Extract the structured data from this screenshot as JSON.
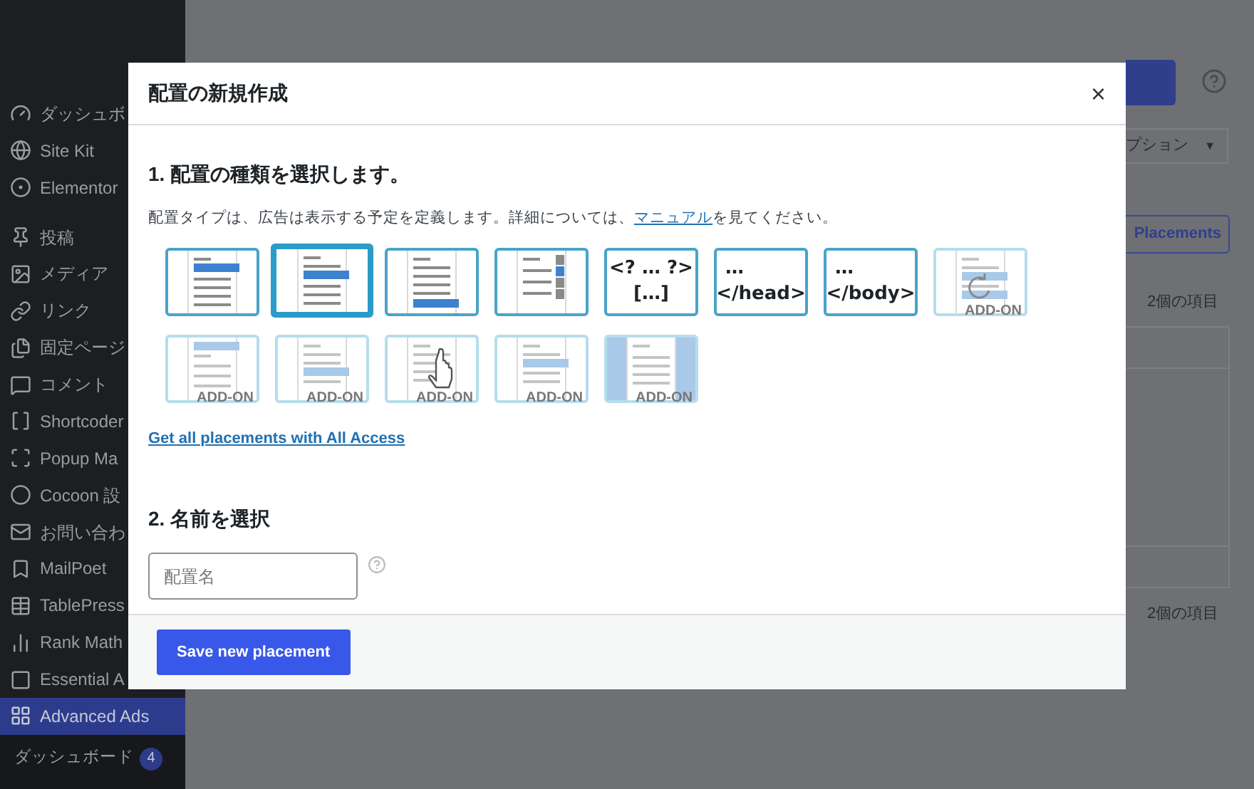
{
  "sidebar": {
    "items": [
      {
        "label": "ダッシュボ",
        "selected": false
      },
      {
        "label": "Site Kit",
        "selected": false
      },
      {
        "label": "Elementor",
        "selected": false
      },
      {
        "label": "投稿",
        "selected": false
      },
      {
        "label": "メディア",
        "selected": false
      },
      {
        "label": "リンク",
        "selected": false
      },
      {
        "label": "固定ページ",
        "selected": false
      },
      {
        "label": "コメント",
        "selected": false
      },
      {
        "label": "Shortcoder",
        "selected": false
      },
      {
        "label": "Popup Ma",
        "selected": false
      },
      {
        "label": "Cocoon 設",
        "selected": false
      },
      {
        "label": "お問い合わ",
        "selected": false
      },
      {
        "label": "MailPoet",
        "selected": false
      },
      {
        "label": "TablePress",
        "selected": false
      },
      {
        "label": "Rank Math",
        "selected": false
      },
      {
        "label": "Essential A",
        "selected": false
      },
      {
        "label": "Advanced Ads",
        "selected": true
      }
    ],
    "submenu": [
      {
        "label": "ダッシュボード",
        "badge": "4"
      }
    ]
  },
  "background": {
    "dropdown": "プション",
    "dropdown_caret": "▼",
    "placements_button": "Placements",
    "counts": [
      "2個の項目",
      "2個の項目"
    ]
  },
  "modal": {
    "title": "配置の新規作成",
    "close": "×",
    "step1": {
      "heading": "1. 配置の種類を選択します。",
      "description": "配置タイプは、広告は表示する予定を定義します。詳細については、",
      "link": "マニュアル",
      "description_end": "を見てください。",
      "placements": [
        {
          "kind": "icon",
          "selected": false
        },
        {
          "kind": "icon",
          "selected": true
        },
        {
          "kind": "icon",
          "selected": false
        },
        {
          "kind": "icon",
          "selected": false
        },
        {
          "kind": "code",
          "lines": [
            "<? … ?>",
            "[…]"
          ],
          "selected": false
        },
        {
          "kind": "code",
          "lines": [
            "…",
            "</head>"
          ],
          "selected": false
        },
        {
          "kind": "code",
          "lines": [
            "…",
            "</body>"
          ],
          "selected": false
        },
        {
          "kind": "icon",
          "badge": "ADD-ON",
          "selected": false
        },
        {
          "kind": "icon",
          "badge": "ADD-ON",
          "selected": false
        },
        {
          "kind": "icon",
          "badge": "ADD-ON",
          "selected": false
        },
        {
          "kind": "icon",
          "badge": "ADD-ON",
          "selected": false
        },
        {
          "kind": "icon",
          "badge": "ADD-ON",
          "selected": false
        },
        {
          "kind": "icon",
          "badge": "ADD-ON",
          "selected": false
        }
      ],
      "all_access_link": "Get all placements with All Access"
    },
    "step2": {
      "heading": "2. 名前を選択",
      "placeholder": "配置名"
    },
    "save_button": "Save new placement"
  }
}
